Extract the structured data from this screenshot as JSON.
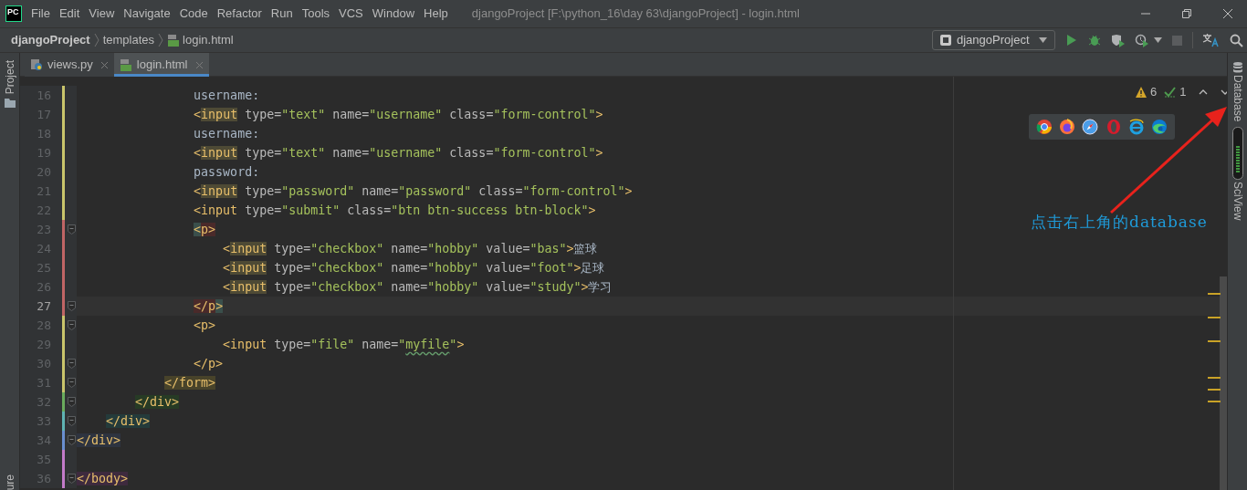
{
  "app": {
    "logo": "PC",
    "menu": [
      "File",
      "Edit",
      "View",
      "Navigate",
      "Code",
      "Refactor",
      "Run",
      "Tools",
      "VCS",
      "Window",
      "Help"
    ],
    "title": "djangoProject [F:\\python_16\\day 63\\djangoProject] - login.html"
  },
  "breadcrumb": [
    "djangoProject",
    "templates",
    "login.html"
  ],
  "run_config": "djangoProject",
  "tabs": [
    {
      "label": "views.py",
      "kind": "python",
      "selected": false
    },
    {
      "label": "login.html",
      "kind": "html",
      "selected": true
    }
  ],
  "left_tool_window": {
    "top": "Project",
    "bottom": "ure"
  },
  "right_tool_windows": [
    "Database",
    "SciView"
  ],
  "inspections": {
    "warnings": "6",
    "weak_warnings": "1"
  },
  "code_lines": [
    {
      "number": "16",
      "color": "#c9c46b",
      "fold": false,
      "current": false,
      "segments": [
        {
          "kind": "text",
          "text": "                username:"
        }
      ]
    },
    {
      "number": "17",
      "color": "#c9c46b",
      "fold": false,
      "current": false,
      "segments": [
        {
          "kind": "tag",
          "text": "                <"
        },
        {
          "kind": "tag",
          "text": "input",
          "color": "#4e4a35"
        },
        {
          "kind": "attr",
          "text": " type="
        },
        {
          "kind": "value",
          "text": "\"text\""
        },
        {
          "kind": "attr",
          "text": " name="
        },
        {
          "kind": "value",
          "text": "\"username\""
        },
        {
          "kind": "attr",
          "text": " class="
        },
        {
          "kind": "value",
          "text": "\"form-control\""
        },
        {
          "kind": "tag",
          "text": ">"
        }
      ]
    },
    {
      "number": "18",
      "color": "#c9c46b",
      "fold": false,
      "current": false,
      "segments": [
        {
          "kind": "text",
          "text": "                username:"
        }
      ]
    },
    {
      "number": "19",
      "color": "#c9c46b",
      "fold": false,
      "current": false,
      "segments": [
        {
          "kind": "tag",
          "text": "                <"
        },
        {
          "kind": "tag",
          "text": "input",
          "color": "#4e4a35"
        },
        {
          "kind": "attr",
          "text": " type="
        },
        {
          "kind": "value",
          "text": "\"text\""
        },
        {
          "kind": "attr",
          "text": " name="
        },
        {
          "kind": "value",
          "text": "\"username\""
        },
        {
          "kind": "attr",
          "text": " class="
        },
        {
          "kind": "value",
          "text": "\"form-control\""
        },
        {
          "kind": "tag",
          "text": ">"
        }
      ]
    },
    {
      "number": "20",
      "color": "#c9c46b",
      "fold": false,
      "current": false,
      "segments": [
        {
          "kind": "text",
          "text": "                password:"
        }
      ]
    },
    {
      "number": "21",
      "color": "#c9c46b",
      "fold": false,
      "current": false,
      "segments": [
        {
          "kind": "tag",
          "text": "                <"
        },
        {
          "kind": "tag",
          "text": "input",
          "color": "#4e4a35"
        },
        {
          "kind": "attr",
          "text": " type="
        },
        {
          "kind": "value",
          "text": "\"password\""
        },
        {
          "kind": "attr",
          "text": " name="
        },
        {
          "kind": "value",
          "text": "\"password\""
        },
        {
          "kind": "attr",
          "text": " class="
        },
        {
          "kind": "value",
          "text": "\"form-control\""
        },
        {
          "kind": "tag",
          "text": ">"
        }
      ]
    },
    {
      "number": "22",
      "color": "#c9c46b",
      "fold": false,
      "current": false,
      "segments": [
        {
          "kind": "tag",
          "text": "                <input"
        },
        {
          "kind": "attr",
          "text": " type="
        },
        {
          "kind": "value",
          "text": "\"submit\""
        },
        {
          "kind": "attr",
          "text": " class="
        },
        {
          "kind": "value",
          "text": "\"btn btn-success btn-block\""
        },
        {
          "kind": "tag",
          "text": ">"
        }
      ]
    },
    {
      "number": "23",
      "color": "#c06565",
      "fold": true,
      "current": false,
      "segments": [
        {
          "kind": "tag",
          "text": "                <",
          "color": "#3a4f4b"
        },
        {
          "kind": "tag",
          "text": "p>",
          "color": "#4a2a2a"
        }
      ]
    },
    {
      "number": "24",
      "color": "#c06565",
      "fold": false,
      "current": false,
      "segments": [
        {
          "kind": "tag",
          "text": "                    <"
        },
        {
          "kind": "tag",
          "text": "input",
          "color": "#4e4a35"
        },
        {
          "kind": "attr",
          "text": " type="
        },
        {
          "kind": "value",
          "text": "\"checkbox\""
        },
        {
          "kind": "attr",
          "text": " name="
        },
        {
          "kind": "value",
          "text": "\"hobby\""
        },
        {
          "kind": "attr",
          "text": " value="
        },
        {
          "kind": "value",
          "text": "\"bas\""
        },
        {
          "kind": "tag",
          "text": ">"
        },
        {
          "kind": "text",
          "text": "篮球"
        }
      ]
    },
    {
      "number": "25",
      "color": "#c06565",
      "fold": false,
      "current": false,
      "segments": [
        {
          "kind": "tag",
          "text": "                    <"
        },
        {
          "kind": "tag",
          "text": "input",
          "color": "#4e4a35"
        },
        {
          "kind": "attr",
          "text": " type="
        },
        {
          "kind": "value",
          "text": "\"checkbox\""
        },
        {
          "kind": "attr",
          "text": " name="
        },
        {
          "kind": "value",
          "text": "\"hobby\""
        },
        {
          "kind": "attr",
          "text": " value="
        },
        {
          "kind": "value",
          "text": "\"foot\""
        },
        {
          "kind": "tag",
          "text": ">"
        },
        {
          "kind": "text",
          "text": "足球"
        }
      ]
    },
    {
      "number": "26",
      "color": "#c06565",
      "fold": false,
      "current": false,
      "segments": [
        {
          "kind": "tag",
          "text": "                    <"
        },
        {
          "kind": "tag",
          "text": "input",
          "color": "#4e4a35"
        },
        {
          "kind": "attr",
          "text": " type="
        },
        {
          "kind": "value",
          "text": "\"checkbox\""
        },
        {
          "kind": "attr",
          "text": " name="
        },
        {
          "kind": "value",
          "text": "\"hobby\""
        },
        {
          "kind": "attr",
          "text": " value="
        },
        {
          "kind": "value",
          "text": "\"study\""
        },
        {
          "kind": "tag",
          "text": ">"
        },
        {
          "kind": "text",
          "text": "学习"
        }
      ]
    },
    {
      "number": "27",
      "color": "#c06565",
      "fold": true,
      "current": true,
      "segments": [
        {
          "kind": "tag",
          "text": "                </p",
          "color": "#4a2a2a"
        },
        {
          "kind": "tag",
          "text": ">",
          "color": "#3a4f4b"
        }
      ]
    },
    {
      "number": "28",
      "color": "#c9c46b",
      "fold": true,
      "current": false,
      "segments": [
        {
          "kind": "tag",
          "text": "                <p>"
        }
      ]
    },
    {
      "number": "29",
      "color": "#c9c46b",
      "fold": false,
      "current": false,
      "segments": [
        {
          "kind": "tag",
          "text": "                    <input"
        },
        {
          "kind": "attr",
          "text": " type="
        },
        {
          "kind": "value",
          "text": "\"file\""
        },
        {
          "kind": "attr",
          "text": " name="
        },
        {
          "kind": "value",
          "text": "\""
        },
        {
          "kind": "misspelled",
          "text": "myfile"
        },
        {
          "kind": "value",
          "text": "\""
        },
        {
          "kind": "tag",
          "text": ">"
        }
      ]
    },
    {
      "number": "30",
      "color": "#c9c46b",
      "fold": true,
      "current": false,
      "segments": [
        {
          "kind": "tag",
          "text": "                </p>"
        }
      ]
    },
    {
      "number": "31",
      "color": "#c9c46b",
      "fold": true,
      "current": false,
      "segments": [
        {
          "kind": "tag",
          "text": "            </form>",
          "color": "#48432a"
        }
      ]
    },
    {
      "number": "32",
      "color": "#6aab5d",
      "fold": true,
      "current": false,
      "segments": [
        {
          "kind": "tag",
          "text": "        </div>",
          "color": "#273b25"
        }
      ]
    },
    {
      "number": "33",
      "color": "#5fb3b3",
      "fold": true,
      "current": false,
      "segments": [
        {
          "kind": "tag",
          "text": "    </div>",
          "color": "#243b3b"
        }
      ]
    },
    {
      "number": "34",
      "color": "#6a8fd0",
      "fold": true,
      "current": false,
      "segments": [
        {
          "kind": "tag",
          "text": "</div>",
          "color": "#2e3440"
        }
      ]
    },
    {
      "number": "35",
      "color": "#c27bc9",
      "fold": false,
      "current": false
    },
    {
      "number": "36",
      "color": "#c27bc9",
      "fold": true,
      "current": false,
      "segments": [
        {
          "kind": "tag",
          "text": "</body>",
          "color": "#3e2a3e"
        }
      ]
    }
  ],
  "annotation": "点击右上角的database"
}
